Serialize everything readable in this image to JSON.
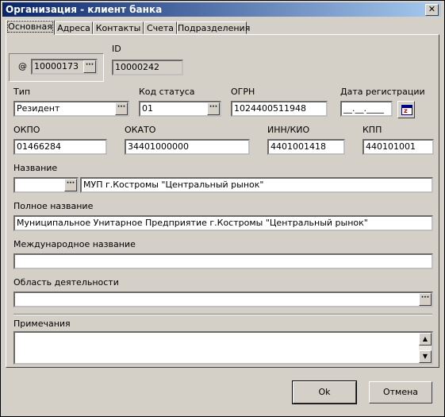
{
  "window": {
    "title": "Организация - клиент банка",
    "close_label": "✕"
  },
  "tabs": [
    "Основная",
    "Адреса",
    "Контакты",
    "Счета",
    "Подразделения"
  ],
  "client_group": {
    "prefix": "@",
    "value": "10000173"
  },
  "id": {
    "label": "ID",
    "value": "10000242"
  },
  "type": {
    "label": "Тип",
    "value": "Резидент"
  },
  "status_code": {
    "label": "Код статуса",
    "value": "01"
  },
  "ogrn": {
    "label": "ОГРН",
    "value": "1024400511948"
  },
  "reg_date": {
    "label": "Дата регистрации",
    "value": "__.__.____"
  },
  "okpo": {
    "label": "ОКПО",
    "value": "01466284"
  },
  "okato": {
    "label": "ОКАТО",
    "value": "34401000000"
  },
  "inn": {
    "label": "ИНН/КИО",
    "value": "4401001418"
  },
  "kpp": {
    "label": "КПП",
    "value": "440101001"
  },
  "name": {
    "label": "Название",
    "prefix_value": "",
    "value": "МУП г.Костромы \"Центральный рынок\""
  },
  "full_name": {
    "label": "Полное название",
    "value": "Муниципальное Унитарное Предприятие г.Костромы \"Центральный рынок\""
  },
  "intl_name": {
    "label": "Международное название",
    "value": ""
  },
  "activity": {
    "label": "Область деятельности",
    "value": ""
  },
  "notes": {
    "label": "Примечания",
    "value": ""
  },
  "buttons": {
    "ok": "Ok",
    "cancel": "Отмена"
  }
}
